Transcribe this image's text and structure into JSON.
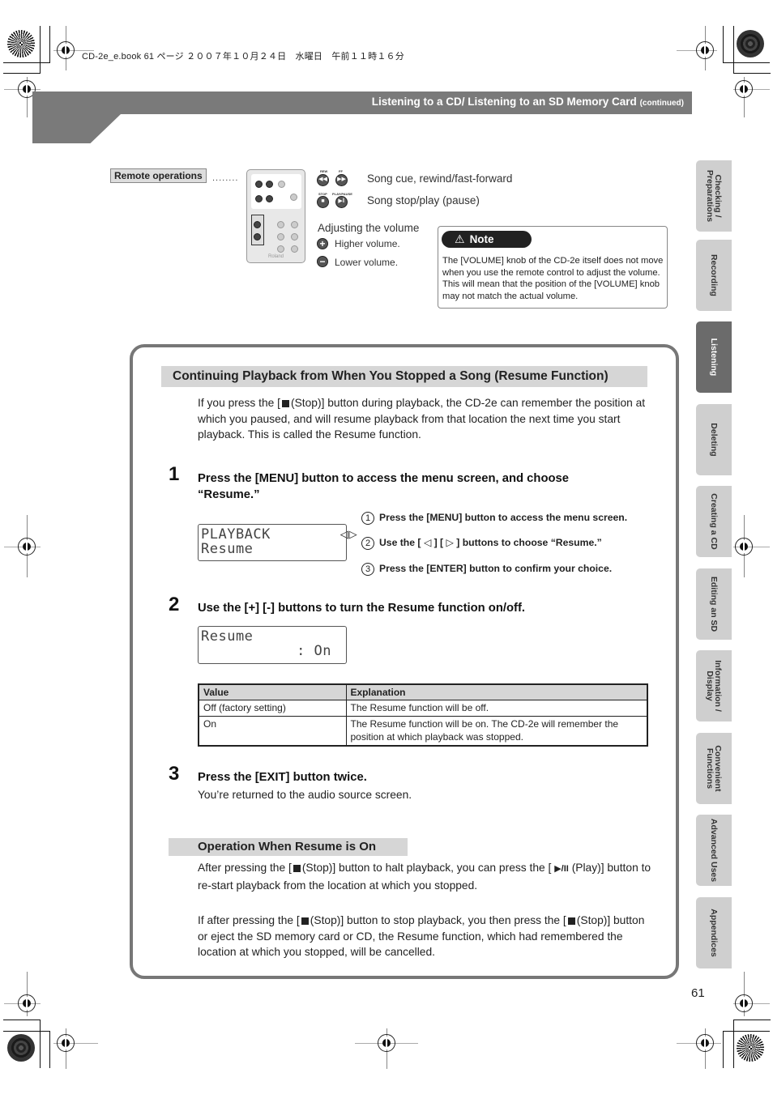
{
  "file_info": "CD-2e_e.book  61 ページ  ２００７年１０月２４日　水曜日　午前１１時１６分",
  "header": {
    "title": "Listening to a CD/ Listening to an SD Memory Card",
    "continued": "(continued)"
  },
  "remote": {
    "label": "Remote operations",
    "dots": "........",
    "brand": "Roland",
    "button_captions": {
      "rew": "REW",
      "ff": "FF",
      "stop": "STOP",
      "play_pause": "PLAY/PAUSE"
    },
    "cue_desc": "Song cue, rewind/fast-forward",
    "stop_play_desc": "Song stop/play (pause)",
    "volume_heading": "Adjusting the volume",
    "volume_up": "Higher volume.",
    "volume_down": "Lower volume.",
    "icons": [
      "rewind-icon",
      "fast-forward-icon",
      "stop-icon",
      "play-pause-icon",
      "plus-icon",
      "minus-icon"
    ]
  },
  "note": {
    "label": "Note",
    "text": "The [VOLUME] knob of the CD-2e itself does not move when you use the remote control to adjust the volume. This will mean that the position of the [VOLUME] knob may not match the actual volume."
  },
  "side_tabs": [
    {
      "label": "Checking / Preparations",
      "active": false
    },
    {
      "label": "Recording",
      "active": false
    },
    {
      "label": "Listening",
      "active": true
    },
    {
      "label": "Deleting",
      "active": false
    },
    {
      "label": "Creating a CD",
      "active": false
    },
    {
      "label": "Editing an SD",
      "active": false
    },
    {
      "label": "Information / Display",
      "active": false
    },
    {
      "label": "Convenient Functions",
      "active": false
    },
    {
      "label": "Advanced Uses",
      "active": false
    },
    {
      "label": "Appendices",
      "active": false
    }
  ],
  "section": {
    "title": "Continuing Playback from When You Stopped a Song (Resume Function)",
    "intro_pre": "If you press the [",
    "intro_post": "(Stop)] button during playback, the CD-2e can remember the position at which you paused, and will resume playback from that location the next time you start playback. This is called the Resume function."
  },
  "steps": [
    {
      "num": "1",
      "title": "Press the [MENU] button to access the menu screen, and choose “Resume.”",
      "lcd": [
        "PLAYBACK        ◁▷",
        "Resume"
      ],
      "sub_steps": [
        {
          "num": "1",
          "text": "Press the [MENU] button to access the menu screen."
        },
        {
          "num": "2",
          "text": "Use the [ ◁ ] [ ▷ ] buttons to choose “Resume.”"
        },
        {
          "num": "3",
          "text": "Press the [ENTER] button to confirm your choice."
        }
      ]
    },
    {
      "num": "2",
      "title": "Use the [+] [-] buttons to turn the Resume function on/off.",
      "lcd": [
        "Resume",
        "           : On"
      ]
    },
    {
      "num": "3",
      "title": "Press the [EXIT] button twice.",
      "desc": "You’re returned to the audio source screen."
    }
  ],
  "table": {
    "headers": [
      "Value",
      "Explanation"
    ],
    "rows": [
      [
        "Off (factory setting)",
        "The Resume function will be off."
      ],
      [
        "On",
        "The Resume function will be on. The CD-2e will remember the position at which playback was stopped."
      ]
    ]
  },
  "subsection": {
    "title": "Operation When Resume is On",
    "p1_a": "After pressing the [",
    "p1_b": "(Stop)] button to halt playback, you can press the [",
    "p1_play": "▶/II",
    "p1_c": "(Play)] button to re-start playback from the location at which you stopped.",
    "p2_a": "If after pressing the [",
    "p2_b": "(Stop)] button to stop playback, you then press the [",
    "p2_c": "(Stop)] button or eject the SD memory card or CD, the Resume function, which had remembered the location at which you stopped, will be cancelled."
  },
  "page_number": "61"
}
